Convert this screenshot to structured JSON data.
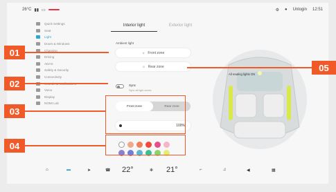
{
  "status": {
    "temperature": "26°C",
    "alert": "",
    "user": "Unlogin",
    "time": "12:51"
  },
  "sidebar": {
    "items": [
      {
        "label": "Quick Settings"
      },
      {
        "label": "Seat"
      },
      {
        "label": "Light"
      },
      {
        "label": "Doors & Windows"
      },
      {
        "label": "Charging"
      },
      {
        "label": "Driving"
      },
      {
        "label": "ADAS"
      },
      {
        "label": "Safety & Security"
      },
      {
        "label": "Connectivity"
      },
      {
        "label": "Sounds & Notifications"
      },
      {
        "label": "Voice"
      },
      {
        "label": "Display"
      },
      {
        "label": "NOMI Lab"
      }
    ]
  },
  "tabs": [
    {
      "label": "Interior light"
    },
    {
      "label": "Exterior light"
    }
  ],
  "ambient": {
    "label": "Ambient light",
    "front_label": "Front zone",
    "rear_label": "Rear zone"
  },
  "sync": {
    "label": "Sync",
    "sublabel": "Sync all light zones"
  },
  "segment": {
    "front": "Front zone",
    "rear": "Rear zone"
  },
  "brightness": {
    "value": "100",
    "unit": "%"
  },
  "car_view": {
    "label": "All reading lights ON"
  },
  "colors": [
    "#ffffff",
    "#f2a98b",
    "#f07f5a",
    "#ef4a3c",
    "#e84d8a",
    "#f6b6c6",
    "#8a7fd0",
    "#6f7fd6",
    "#5db7d3",
    "#3fbf8f",
    "#8dd46b",
    "#e5ec6f"
  ],
  "callouts": {
    "c1": "01",
    "c2": "02",
    "c3": "03",
    "c4": "04",
    "c5": "05"
  },
  "bottombar": {
    "left_temp": "22",
    "right_temp": "21",
    "unit": "°"
  },
  "accent": "#2ea8c8",
  "callout_color": "#f05a28"
}
